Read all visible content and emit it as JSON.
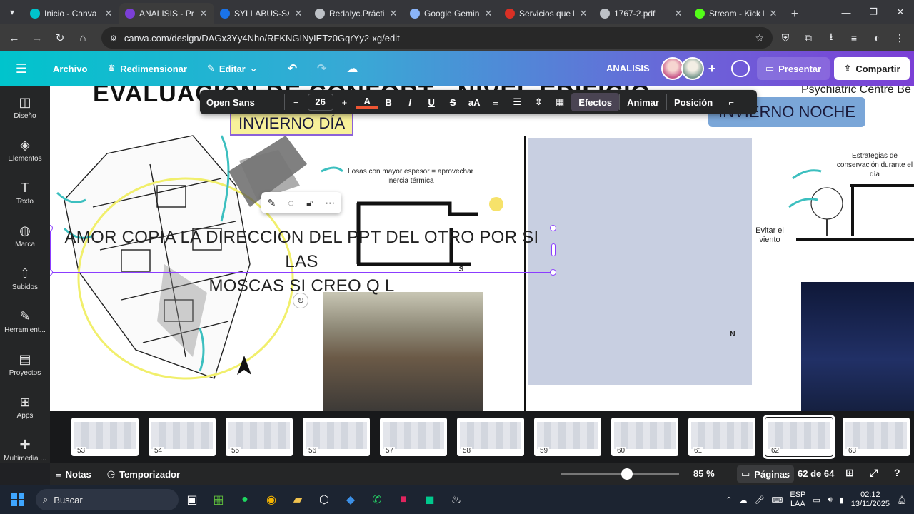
{
  "browser": {
    "tabs": [
      {
        "title": "Inicio - Canva",
        "color": "#00c4cc",
        "active": false
      },
      {
        "title": "ANALISIS - Prese",
        "color": "#7b3fd6",
        "active": true
      },
      {
        "title": "SYLLABUS-SALU",
        "color": "#1a73e8",
        "active": false
      },
      {
        "title": "Redalyc.Práctica",
        "color": "#bdc1c6",
        "active": false
      },
      {
        "title": "Google Gemini",
        "color": "#8ab4f8",
        "active": false
      },
      {
        "title": "Servicios que br",
        "color": "#d93025",
        "active": false
      },
      {
        "title": "1767-2.pdf",
        "color": "#bdc1c6",
        "active": false
      },
      {
        "title": "Stream - Kick D",
        "color": "#53fc18",
        "active": false
      }
    ],
    "url": "canva.com/design/DAGx3Yy4Nho/RFKNGINyIETz0GqrYy2-xg/edit"
  },
  "canva": {
    "menu": {
      "archivo": "Archivo",
      "redimensionar": "Redimensionar",
      "editar": "Editar"
    },
    "doc_title": "ANALISIS",
    "presentar": "Presentar",
    "compartir": "Compartir",
    "sidebar": [
      {
        "label": "Diseño",
        "icon": "layout-icon"
      },
      {
        "label": "Elementos",
        "icon": "shapes-icon"
      },
      {
        "label": "Texto",
        "icon": "text-icon"
      },
      {
        "label": "Marca",
        "icon": "brand-icon"
      },
      {
        "label": "Subidos",
        "icon": "upload-icon"
      },
      {
        "label": "Herramient...",
        "icon": "draw-icon"
      },
      {
        "label": "Proyectos",
        "icon": "folder-icon"
      },
      {
        "label": "Apps",
        "icon": "apps-icon"
      },
      {
        "label": "Multimedia ...",
        "icon": "media-icon"
      }
    ],
    "textbar": {
      "font": "Open Sans",
      "size": "26",
      "efectos": "Efectos",
      "animar": "Animar",
      "posicion": "Posición"
    },
    "slide": {
      "title": "EVALUACIÓN DE CONFORT - NIVEL EDIFICIO",
      "invierno_dia": "INVIERNO DÍA",
      "invierno_noche": "INVIERNO NOCHE",
      "psych": "Psychiatric Centre Be",
      "losas_note": "Losas con mayor espesor = aprovechar inercia térmica",
      "estrategias_note": "Estrategias de conservación durante el día",
      "viento_note": "Evitar el viento",
      "north": "N",
      "south": "S",
      "caption_line1": "AMOR COPIA LA DIRECCION DEL PPT DEL OTRO POR SI LAS",
      "caption_line2": "MOSCAS SI CREO Q L"
    },
    "pages": [
      "53",
      "54",
      "55",
      "56",
      "57",
      "58",
      "59",
      "60",
      "61",
      "62",
      "63"
    ],
    "active_page": "62",
    "bottom": {
      "notas": "Notas",
      "temporizador": "Temporizador",
      "zoom": "85 %",
      "zoom_level": 0.56,
      "paginas": "Páginas",
      "page_count": "62 de 64"
    }
  },
  "taskbar": {
    "search": "Buscar",
    "lang_1": "ESP",
    "lang_2": "LAA",
    "time": "02:12",
    "date": "13/11/2025"
  }
}
